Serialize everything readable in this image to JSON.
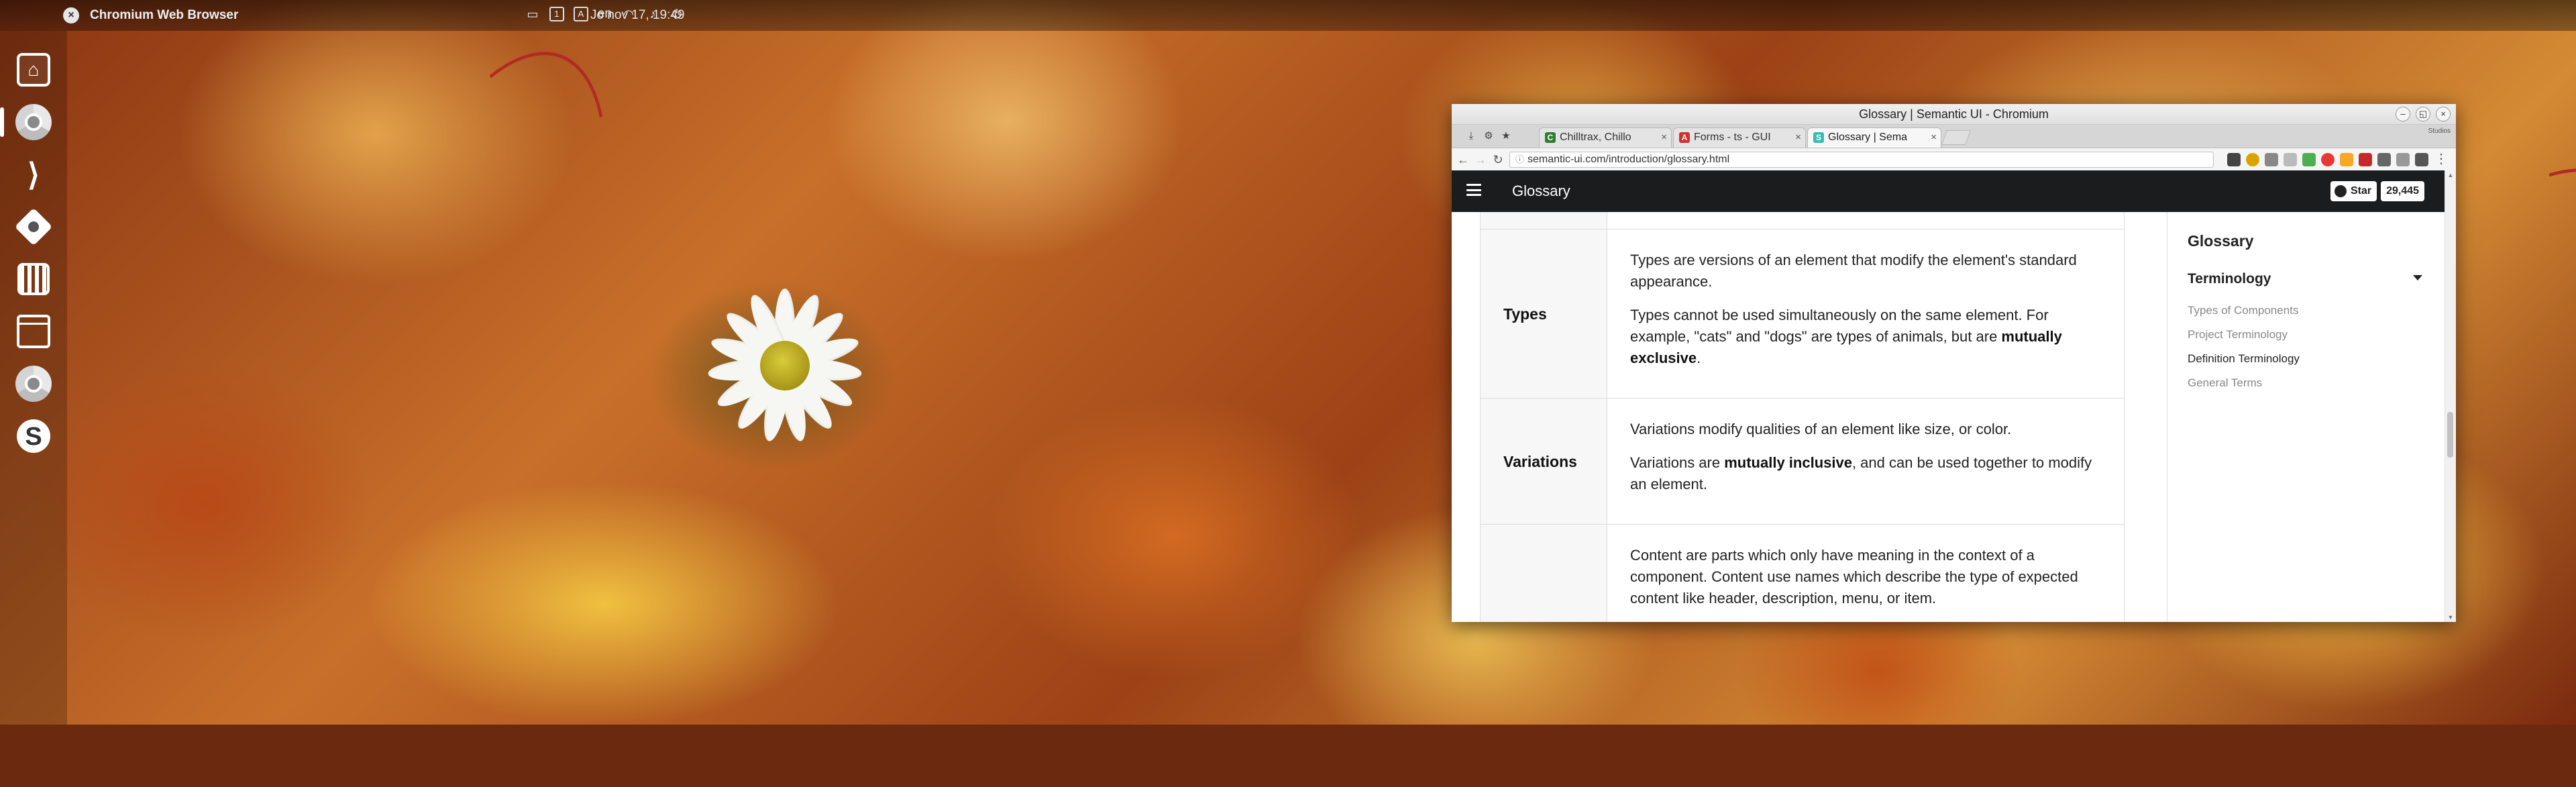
{
  "panel": {
    "app_name": "Chromium Web Browser",
    "clock": "Jo nov 17, 19:49",
    "keyboard_layout": "en",
    "workspace_badge": "1",
    "notify_badge": "A"
  },
  "dock": {
    "items": [
      {
        "name": "Home",
        "icon": "home-icon"
      },
      {
        "name": "Chromium",
        "icon": "chrome-icon"
      },
      {
        "name": "Visual Studio Code",
        "icon": "vscode-icon"
      },
      {
        "name": "Git",
        "icon": "git-icon"
      },
      {
        "name": "Piano",
        "icon": "piano-icon"
      },
      {
        "name": "Window",
        "icon": "window-icon"
      },
      {
        "name": "Chrome",
        "icon": "chrome-icon"
      },
      {
        "name": "Skype",
        "icon": "skype-icon"
      }
    ]
  },
  "browser": {
    "window_title": "Glossary | Semantic UI - Chromium",
    "profile": "Studios",
    "tabs": [
      {
        "label": "Chilltrax, Chillo",
        "favicon_color": "#2e7d32",
        "favicon_letter": "C"
      },
      {
        "label": "Forms - ts - GUI",
        "favicon_color": "#d32f2f",
        "favicon_letter": "A"
      },
      {
        "label": "Glossary | Sema",
        "favicon_color": "#35bdb2",
        "favicon_letter": "S",
        "active": true
      }
    ],
    "url": "semantic-ui.com/introduction/glossary.html"
  },
  "site": {
    "header_title": "Glossary",
    "github_star_label": "Star",
    "github_star_count": "29,445"
  },
  "glossary": {
    "rows": [
      {
        "term": "Types",
        "p1": "Types are versions of an element that modify the element's standard appearance.",
        "p2_before": "Types cannot be used simultaneously on the same element. For example, \"cats\" and \"dogs\" are types of animals, but are ",
        "p2_bold": "mutually exclusive",
        "p2_after": "."
      },
      {
        "term": "Variations",
        "p1": "Variations modify qualities of an element like size, or color.",
        "p2_before": "Variations are ",
        "p2_bold": "mutually inclusive",
        "p2_after": ", and can be used together to modify an element."
      },
      {
        "term": "",
        "p1": "Content are parts which only have meaning in the context of a component. Content use names which describe the type of expected content like header, description, menu, or item."
      }
    ]
  },
  "sidebar": {
    "heading": "Glossary",
    "section": "Terminology",
    "links": [
      {
        "label": "Types of Components",
        "current": false
      },
      {
        "label": "Project Terminology",
        "current": false
      },
      {
        "label": "Definition Terminology",
        "current": true
      },
      {
        "label": "General Terms",
        "current": false
      }
    ]
  }
}
